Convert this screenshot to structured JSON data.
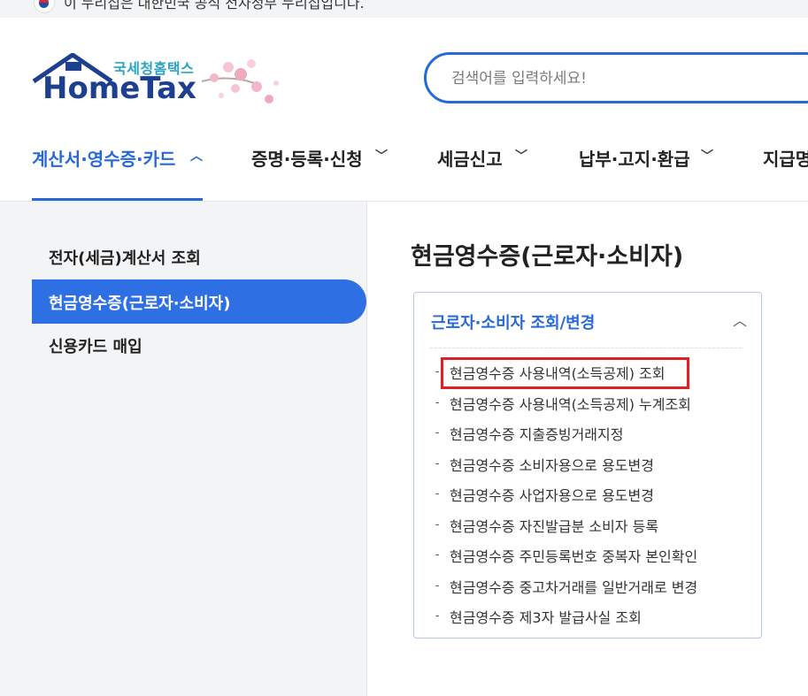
{
  "topbar": {
    "notice": "이 누리집은 대한민국 공식 전자정부 누리집입니다."
  },
  "logo": {
    "sub": "국세청홈택스",
    "main": "HomeTax"
  },
  "search": {
    "placeholder": "검색어를 입력하세요!"
  },
  "nav": {
    "items": [
      {
        "label": "계산서·영수증·카드",
        "icon": "chevron-up-icon"
      },
      {
        "label": "증명·등록·신청",
        "icon": "chevron-down-icon"
      },
      {
        "label": "세금신고",
        "icon": "chevron-down-icon"
      },
      {
        "label": "납부·고지·환급",
        "icon": "chevron-down-icon"
      },
      {
        "label": "지급명"
      }
    ]
  },
  "sidebar": {
    "items": [
      {
        "label": "전자(세금)계산서 조회"
      },
      {
        "label": "현금영수증(근로자·소비자)"
      },
      {
        "label": "신용카드 매입"
      }
    ]
  },
  "content": {
    "title": "현금영수증(근로자·소비자)",
    "panel": {
      "title": "근로자·소비자 조회/변경",
      "toggle_icon": "chevron-up-icon",
      "items": [
        "현금영수증 사용내역(소득공제) 조회",
        "현금영수증 사용내역(소득공제) 누계조회",
        "현금영수증 지출증빙거래지정",
        "현금영수증 소비자용으로 용도변경",
        "현금영수증 사업자용으로 용도변경",
        "현금영수증 자진발급분 소비자 등록",
        "현금영수증 주민등록번호 중복자 본인확인",
        "현금영수증 중고차거래를 일반거래로 변경",
        "현금영수증 제3자 발급사실 조회"
      ]
    }
  },
  "colors": {
    "accent": "#2769d7",
    "active_bg": "#2e70e4",
    "highlight": "#e02020",
    "sidebar_bg": "#f3f4f6"
  }
}
